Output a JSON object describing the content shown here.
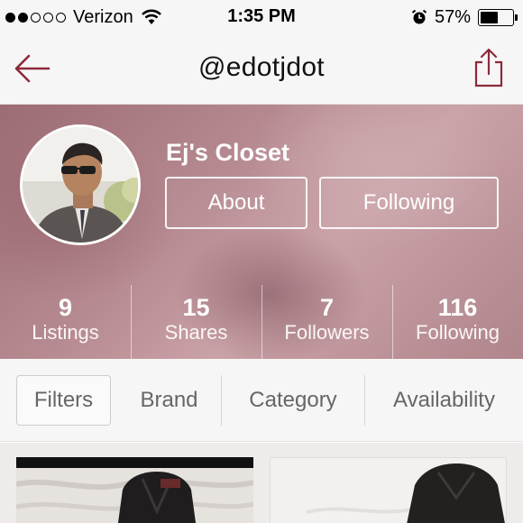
{
  "status_bar": {
    "carrier": "Verizon",
    "time": "1:35 PM",
    "battery_percent": "57%",
    "battery_level": 0.57,
    "signal_bars_filled": 2,
    "signal_bars_total": 5
  },
  "nav": {
    "title": "@edotjdot",
    "back_icon": "back-arrow-icon",
    "share_icon": "share-icon"
  },
  "profile": {
    "closet_name": "Ej's Closet",
    "about_label": "About",
    "following_label": "Following",
    "stats": [
      {
        "value": "9",
        "label": "Listings"
      },
      {
        "value": "15",
        "label": "Shares"
      },
      {
        "value": "7",
        "label": "Followers"
      },
      {
        "value": "116",
        "label": "Following"
      }
    ]
  },
  "filters": {
    "filters_label": "Filters",
    "brand_label": "Brand",
    "category_label": "Category",
    "availability_label": "Availability"
  },
  "colors": {
    "accent": "#8b2a3a",
    "header_tint": "#b88c93",
    "bar_background": "#f7f6f6"
  }
}
